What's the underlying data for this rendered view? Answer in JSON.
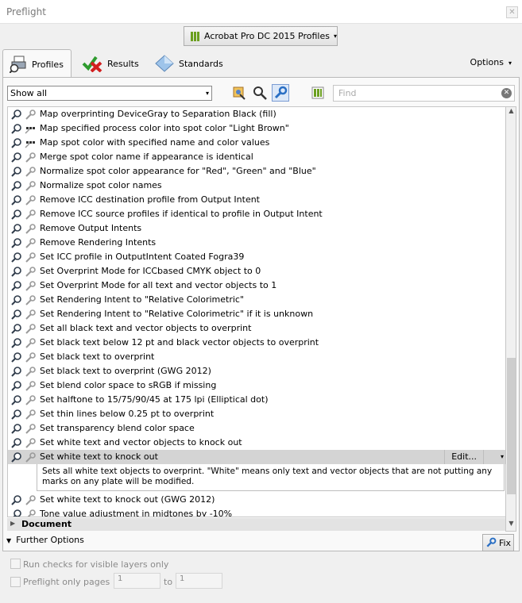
{
  "window": {
    "title": "Preflight",
    "close": "✕"
  },
  "profile_menu": {
    "label": "Acrobat Pro DC 2015 Profiles",
    "caret": "▾"
  },
  "tabs": [
    {
      "label": "Profiles",
      "icon": "profiles-icon",
      "active": true
    },
    {
      "label": "Results",
      "icon": "results-icon",
      "active": false
    },
    {
      "label": "Standards",
      "icon": "standards-icon",
      "active": false
    }
  ],
  "options": {
    "label": "Options",
    "caret": "▾"
  },
  "toolbar": {
    "show_filter": "Show all",
    "caret": "▾",
    "find_placeholder": "Find",
    "clear": "✕"
  },
  "fixups": [
    "Map overprinting DeviceGray to Separation Black (fill)",
    "Map specified process color into spot color \"Light Brown\"",
    "Map spot color with specified name and color values",
    "Merge spot color name if appearance is identical",
    "Normalize spot color appearance for \"Red\", \"Green\" and \"Blue\"",
    "Normalize spot color names",
    "Remove ICC destination profile from Output Intent",
    "Remove ICC source profiles if identical to profile in Output Intent",
    "Remove Output Intents",
    "Remove Rendering Intents",
    "Set ICC profile in OutputIntent Coated Fogra39",
    "Set Overprint Mode for ICCbased CMYK object to 0",
    "Set Overprint Mode for all text and vector objects to 1",
    "Set Rendering Intent to \"Relative Colorimetric\"",
    "Set Rendering Intent to \"Relative Colorimetric\" if it is unknown",
    "Set all black text and vector objects to overprint",
    "Set black text below 12 pt and black vector objects to overprint",
    "Set black text to overprint",
    "Set black text to overprint (GWG 2012)",
    "Set blend color space to sRGB if missing",
    "Set halftone to 15/75/90/45 at 175 lpi (Elliptical dot)",
    "Set thin lines below 0.25 pt to overprint",
    "Set transparency blend color space",
    "Set white text and vector objects to knock out",
    "Set white text to knock out"
  ],
  "selected": {
    "label": "Set white text to knock out",
    "edit": "Edit...",
    "caret": "▾",
    "description": "Sets all white text objects to overprint. \"White\" means only text and vector objects that are not putting any marks on any plate will be modified."
  },
  "after": [
    "Set white text to knock out (GWG 2012)",
    "Tone value adjustment in midtones by -10%"
  ],
  "group": {
    "label": "Document",
    "tri": "▶"
  },
  "further": {
    "label": "Further Options",
    "tri": "▼"
  },
  "fix_button": "Fix",
  "check_visible_layers": "Run checks for visible layers only",
  "preflight_pages": {
    "label": "Preflight only pages",
    "from": "1",
    "to_label": "to",
    "to": "1"
  },
  "scroll": {
    "up": "▲",
    "down": "▼"
  }
}
